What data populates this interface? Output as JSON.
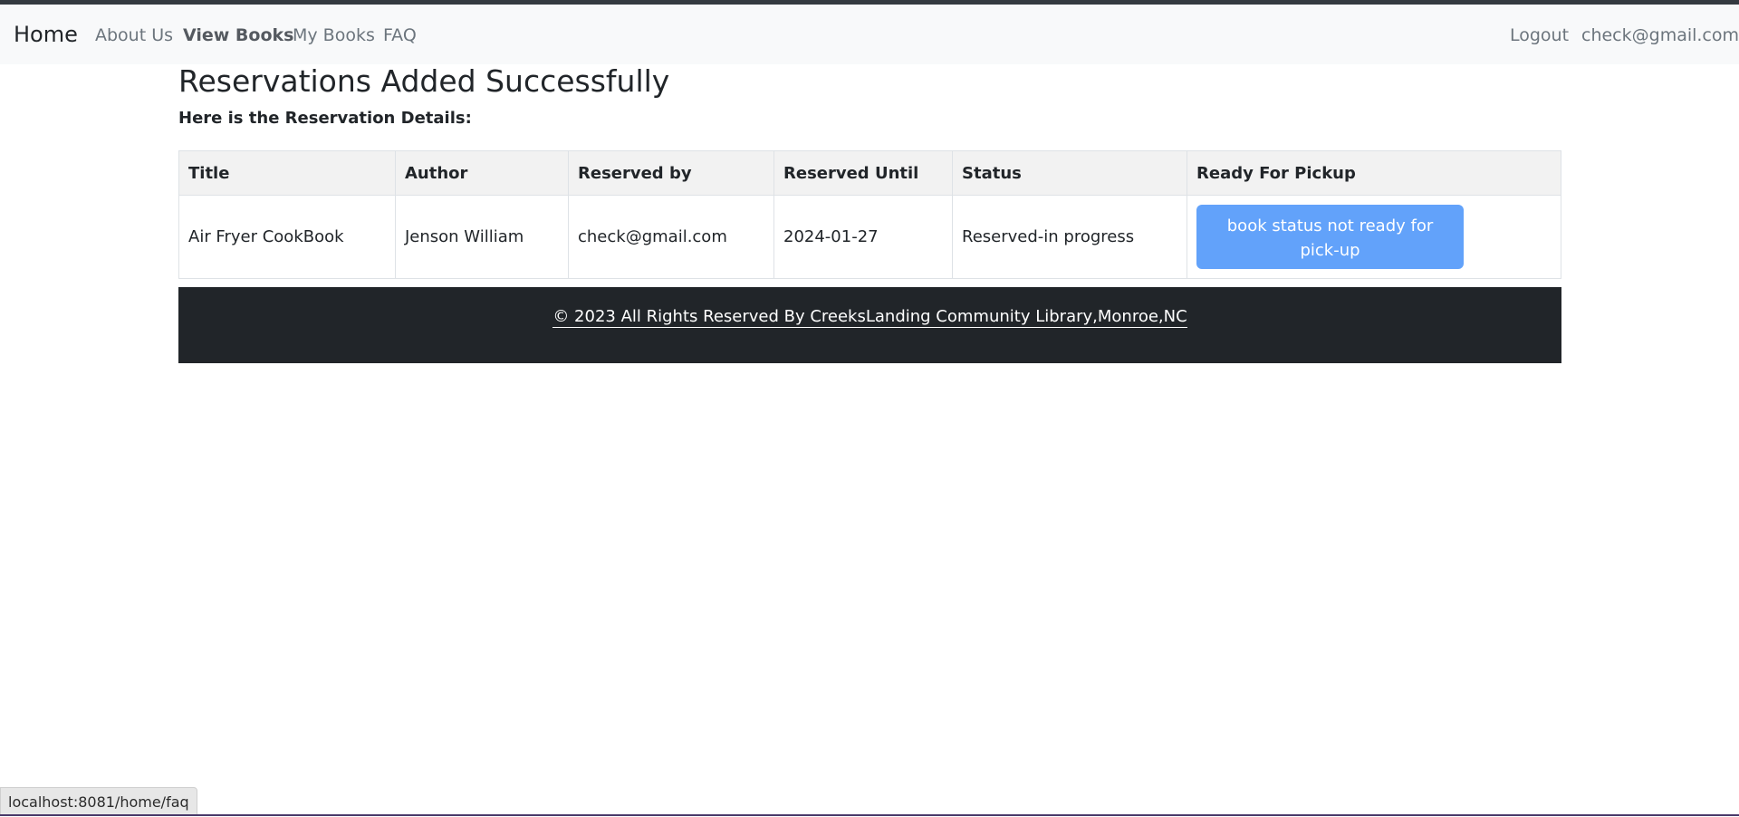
{
  "nav": {
    "brand": "Home",
    "links": [
      "About Us",
      "View Books",
      "My Books",
      "FAQ"
    ],
    "logout": "Logout",
    "user_email": "check@gmail.com"
  },
  "page": {
    "title": "Reservations Added Successfully",
    "subtitle": "Here is the Reservation Details:"
  },
  "table": {
    "headers": [
      "Title",
      "Author",
      "Reserved by",
      "Reserved Until",
      "Status",
      "Ready For Pickup"
    ],
    "rows": [
      {
        "title": "Air Fryer CookBook",
        "author": "Jenson William",
        "reserved_by": "check@gmail.com",
        "reserved_until": "2024-01-27",
        "status": "Reserved-in progress",
        "pickup_button": "book status not ready for pick-up"
      }
    ]
  },
  "footer": {
    "text": "© 2023 All Rights Reserved By CreeksLanding Community Library,Monroe,NC"
  },
  "status_bar": {
    "url": "localhost:8081/home/faq"
  },
  "colors": {
    "navbar_bg": "#f8f9fa",
    "footer_bg": "#212529",
    "button_bg": "#62a2fa",
    "header_bg": "#f2f2f2"
  }
}
